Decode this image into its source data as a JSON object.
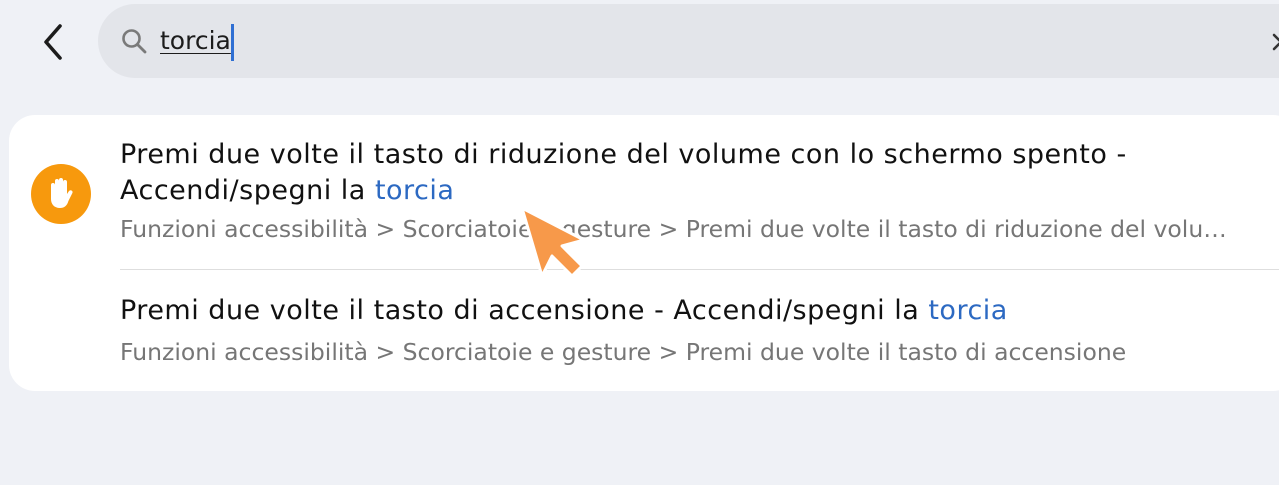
{
  "search": {
    "query": "torcia"
  },
  "results": [
    {
      "title_prefix": "Premi due volte il tasto di riduzione del volume con lo schermo spento -",
      "title_line2_prefix": "Accendi/spegni la ",
      "highlight": "torcia",
      "path": "Funzioni accessibilità > Scorciatoie e gesture > Premi due volte il tasto di riduzione del volu…"
    },
    {
      "title_prefix": "Premi due volte il tasto di accensione - Accendi/spegni la ",
      "highlight": "torcia",
      "path": "Funzioni accessibilità > Scorciatoie e gesture > Premi due volte il tasto di accensione"
    }
  ],
  "icons": {
    "back": "chevron-left-icon",
    "search": "search-icon",
    "clear": "close-icon",
    "result_app": "hand-icon",
    "pointer": "arrow-pointer-icon"
  },
  "colors": {
    "background": "#eff1f6",
    "search_bar": "#e3e5ea",
    "card": "#ffffff",
    "highlight": "#2c69c2",
    "app_icon": "#f7990d",
    "pointer_arrow": "#f7994a"
  }
}
